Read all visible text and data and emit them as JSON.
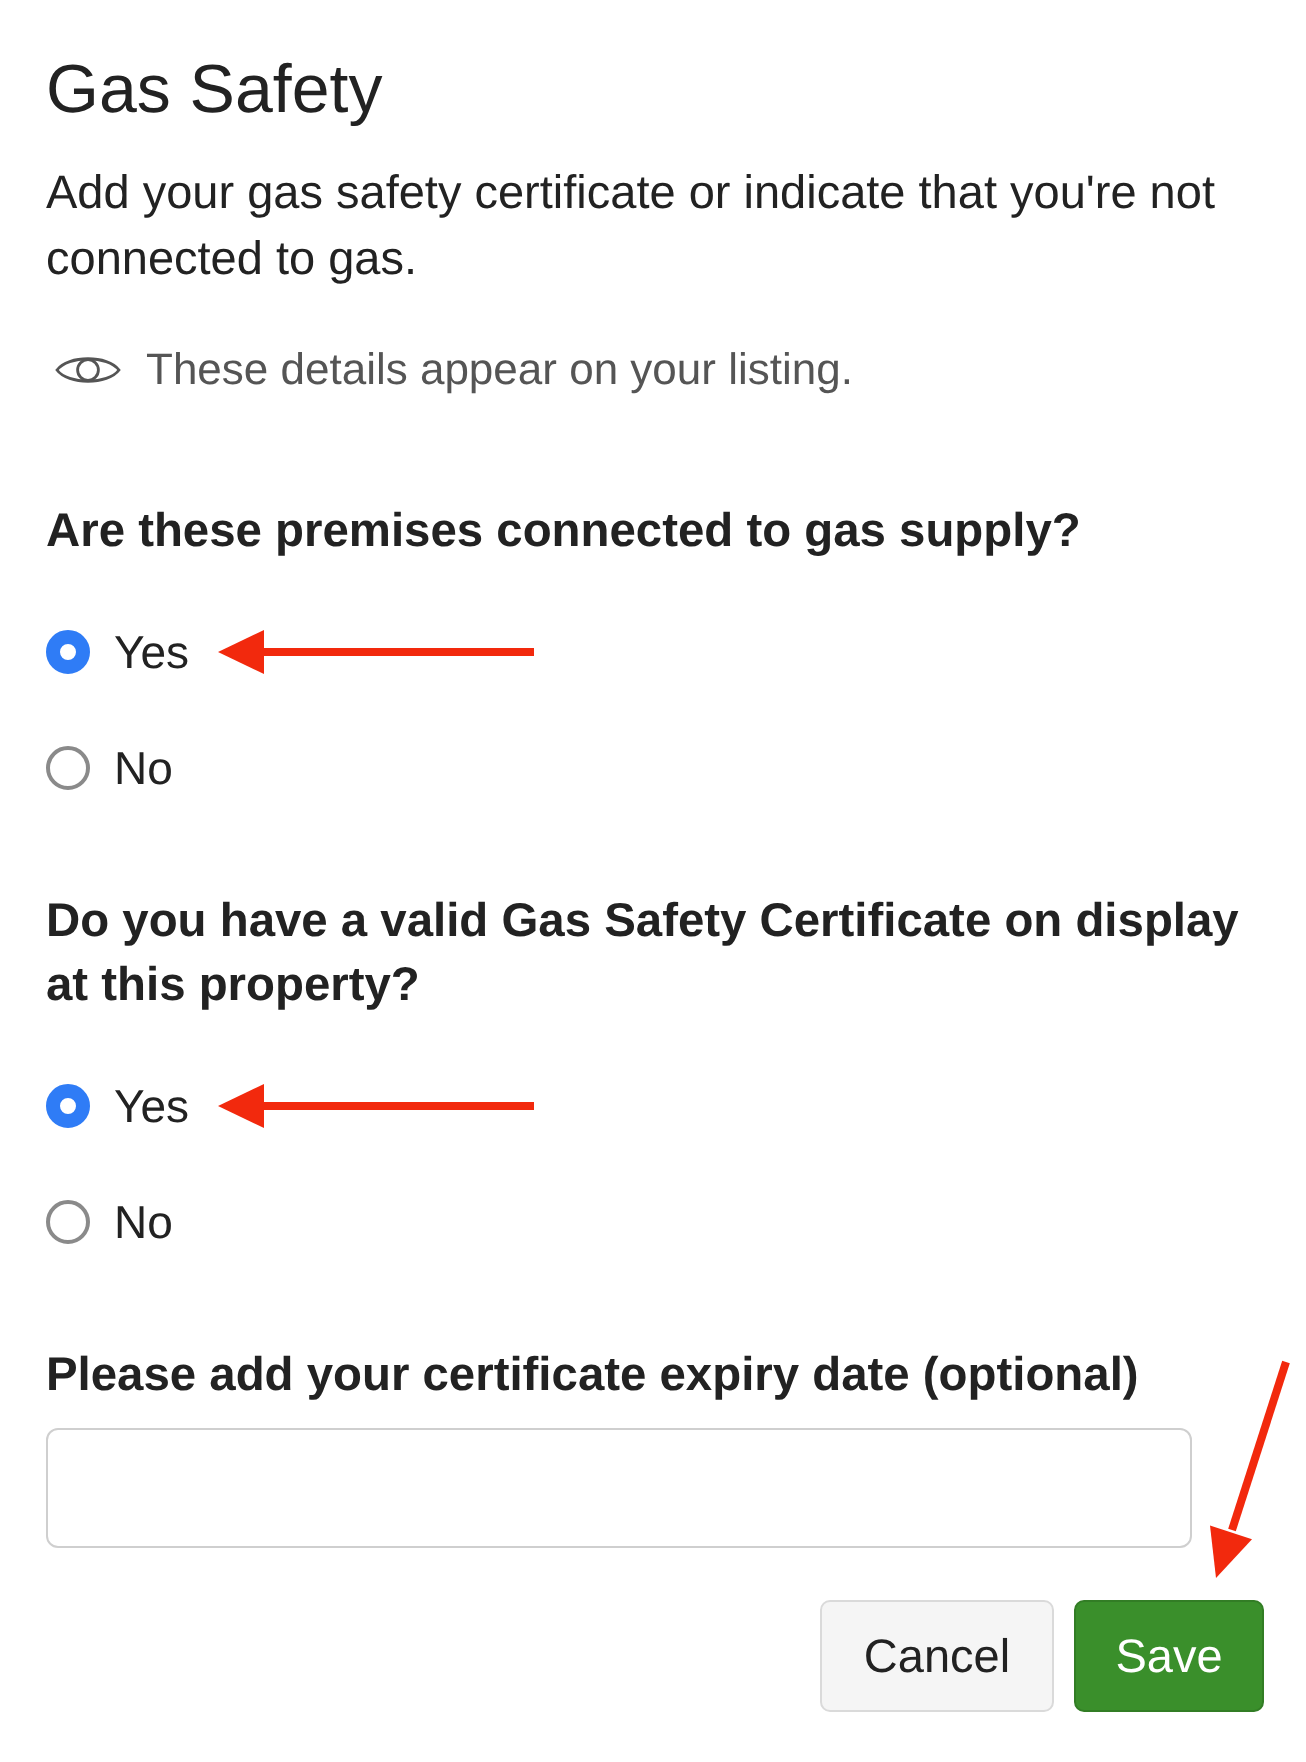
{
  "title": "Gas Safety",
  "description": "Add your gas safety certificate or indicate that you're not connected to gas.",
  "notice": {
    "text": "These details appear on your listing."
  },
  "questions": [
    {
      "text": "Are these premises connected to gas supply?",
      "options": [
        {
          "label": "Yes",
          "selected": true,
          "annotated": true
        },
        {
          "label": "No",
          "selected": false,
          "annotated": false
        }
      ]
    },
    {
      "text": "Do you have a valid Gas Safety Certificate on display at this property?",
      "options": [
        {
          "label": "Yes",
          "selected": true,
          "annotated": true
        },
        {
          "label": "No",
          "selected": false,
          "annotated": false
        }
      ]
    }
  ],
  "expiry_field": {
    "label": "Please add your certificate expiry date (optional)"
  },
  "buttons": [
    {
      "label": "Cancel",
      "kind": "secondary",
      "annotated": false
    },
    {
      "label": "Save",
      "kind": "primary",
      "annotated": true
    }
  ]
}
